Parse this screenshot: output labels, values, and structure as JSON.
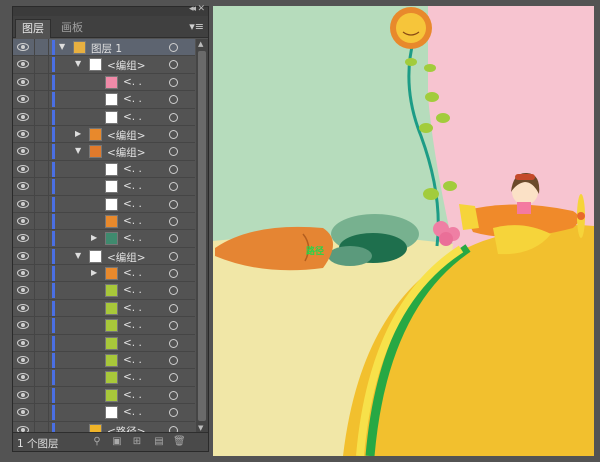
{
  "panel": {
    "tabs": [
      {
        "label": "图层"
      },
      {
        "label": "画板"
      }
    ],
    "footer": {
      "layer_count": "1 个图层"
    },
    "rows": [
      {
        "label": "图层  1",
        "indent": 0,
        "expand": "open",
        "thumb": "layer",
        "selected": true
      },
      {
        "label": "<编组>",
        "indent": 1,
        "expand": "open",
        "thumb": "stroke"
      },
      {
        "label": "<. .",
        "indent": 2,
        "expand": "none",
        "thumb": "pink"
      },
      {
        "label": "<. .",
        "indent": 2,
        "expand": "none",
        "thumb": "stroke"
      },
      {
        "label": "<. .",
        "indent": 2,
        "expand": "none",
        "thumb": "stroke"
      },
      {
        "label": "<编组>",
        "indent": 1,
        "expand": "closed",
        "thumb": "orange"
      },
      {
        "label": "<编组>",
        "indent": 1,
        "expand": "open",
        "thumb": "carrot"
      },
      {
        "label": "<. .",
        "indent": 2,
        "expand": "none",
        "thumb": "blank"
      },
      {
        "label": "<. .",
        "indent": 2,
        "expand": "none",
        "thumb": "stroke"
      },
      {
        "label": "<. .",
        "indent": 2,
        "expand": "none",
        "thumb": "stroke"
      },
      {
        "label": "<. .",
        "indent": 2,
        "expand": "none",
        "thumb": "orange"
      },
      {
        "label": "<. .",
        "indent": 2,
        "expand": "closed",
        "thumb": "teal"
      },
      {
        "label": "<编组>",
        "indent": 1,
        "expand": "open",
        "thumb": "stroke"
      },
      {
        "label": "<. .",
        "indent": 2,
        "expand": "closed",
        "thumb": "orange"
      },
      {
        "label": "<. .",
        "indent": 2,
        "expand": "none",
        "thumb": "green"
      },
      {
        "label": "<. .",
        "indent": 2,
        "expand": "none",
        "thumb": "green"
      },
      {
        "label": "<. .",
        "indent": 2,
        "expand": "none",
        "thumb": "green"
      },
      {
        "label": "<. .",
        "indent": 2,
        "expand": "none",
        "thumb": "green"
      },
      {
        "label": "<. .",
        "indent": 2,
        "expand": "none",
        "thumb": "green"
      },
      {
        "label": "<. .",
        "indent": 2,
        "expand": "none",
        "thumb": "green"
      },
      {
        "label": "<. .",
        "indent": 2,
        "expand": "none",
        "thumb": "green"
      },
      {
        "label": "<. .",
        "indent": 2,
        "expand": "none",
        "thumb": "stroke"
      },
      {
        "label": "<路径>",
        "indent": 1,
        "expand": "none",
        "thumb": "yellow"
      },
      {
        "label": "<路径>",
        "indent": 1,
        "expand": "none",
        "thumb": "mint"
      }
    ]
  },
  "thumb_colors": {
    "layer": "#e8b040",
    "stroke": "#ffffff",
    "pink": "#f08aa8",
    "orange": "#e8892c",
    "carrot": "#e07a2c",
    "blank": "#ffffff",
    "teal": "#3f8a6e",
    "green": "#a8c83a",
    "yellow": "#f0b429",
    "mint": "#b6dcbc"
  },
  "artwork": {
    "path_label": "路径"
  },
  "colors": {
    "layer_color": "#4a6fe3",
    "selected_row": "#5d6470"
  }
}
